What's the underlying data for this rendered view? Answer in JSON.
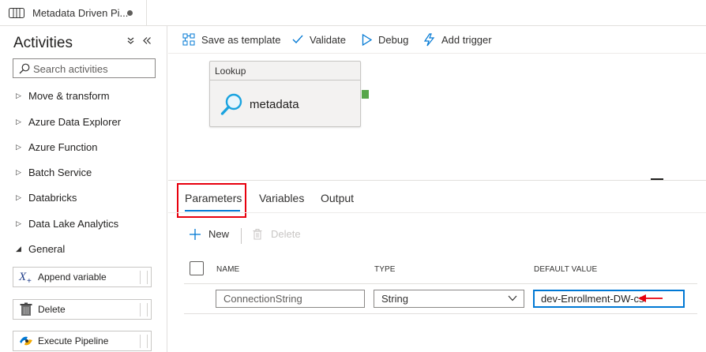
{
  "tab": {
    "title": "Metadata Driven Pi..."
  },
  "sidebar": {
    "title": "Activities",
    "search_placeholder": "Search activities",
    "categories": [
      {
        "label": "Move & transform",
        "expanded": false
      },
      {
        "label": "Azure Data Explorer",
        "expanded": false
      },
      {
        "label": "Azure Function",
        "expanded": false
      },
      {
        "label": "Batch Service",
        "expanded": false
      },
      {
        "label": "Databricks",
        "expanded": false
      },
      {
        "label": "Data Lake Analytics",
        "expanded": false
      },
      {
        "label": "General",
        "expanded": true
      }
    ],
    "activities": [
      {
        "label": "Append variable",
        "icon": "append-variable-icon"
      },
      {
        "label": "Delete",
        "icon": "delete-icon"
      },
      {
        "label": "Execute Pipeline",
        "icon": "execute-pipeline-icon"
      }
    ]
  },
  "toolbar": {
    "save_template": "Save as template",
    "validate": "Validate",
    "debug": "Debug",
    "add_trigger": "Add trigger"
  },
  "canvas": {
    "activity": {
      "type": "Lookup",
      "name": "metadata",
      "icon": "lookup-icon"
    }
  },
  "panel": {
    "tabs": [
      "Parameters",
      "Variables",
      "Output"
    ],
    "active_tab": "Parameters",
    "new_label": "New",
    "delete_label": "Delete",
    "columns": {
      "name": "NAME",
      "type": "TYPE",
      "default": "DEFAULT VALUE"
    },
    "rows": [
      {
        "name": "ConnectionString",
        "type": "String",
        "default": "dev-Enrollment-DW-cs"
      }
    ]
  },
  "colors": {
    "accent": "#0078d4",
    "highlight": "#e8000d",
    "connector": "#57a64a"
  }
}
